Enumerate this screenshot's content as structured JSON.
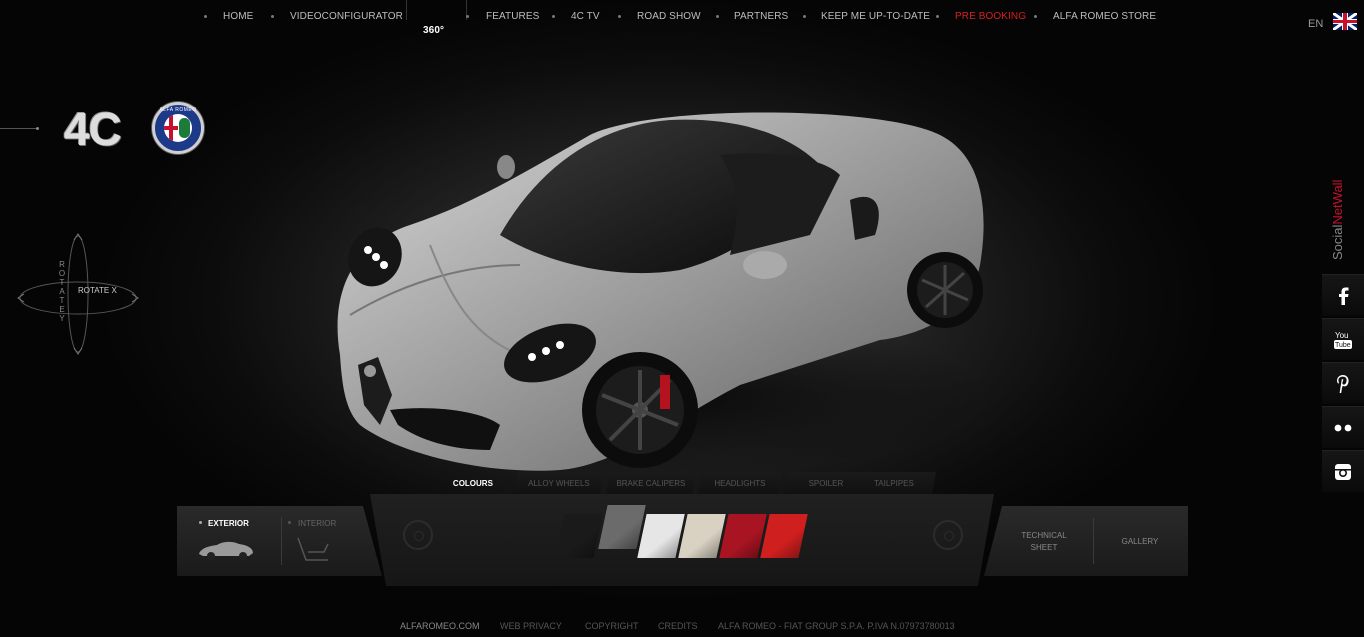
{
  "nav": {
    "items": [
      "HOME",
      "VIDEOCONFIGURATOR",
      "FEATURES",
      "4C TV",
      "ROAD SHOW",
      "PARTNERS",
      "KEEP ME UP-TO-DATE",
      "PRE BOOKING",
      "ALFA ROMEO STORE"
    ],
    "active_item": "PRE BOOKING",
    "tag": "360°"
  },
  "language": {
    "code": "EN",
    "flag": "uk-flag-icon"
  },
  "branding": {
    "model": "4C",
    "badge_text": "ALFA ROMEO",
    "badge_icon": "alfa-romeo-badge-icon"
  },
  "rotate": {
    "y_label": "ROTATE Y",
    "x_label": "ROTATE X"
  },
  "tabs": [
    "COLOURS",
    "ALLOY WHEELS",
    "BRAKE CALIPERS",
    "HEADLIGHTS",
    "SPOILER",
    "TAILPIPES"
  ],
  "active_tab": "COLOURS",
  "view_modes": {
    "exterior": "EXTERIOR",
    "interior": "INTERIOR",
    "active": "EXTERIOR"
  },
  "swatches": [
    {
      "color": "#1a1a1a",
      "name": "black"
    },
    {
      "color": "#6b6b6b",
      "name": "grey"
    },
    {
      "color": "#e6e6e6",
      "name": "white"
    },
    {
      "color": "#d9d2c3",
      "name": "pearl"
    },
    {
      "color": "#a81422",
      "name": "dark-red"
    },
    {
      "color": "#d01f1f",
      "name": "red"
    }
  ],
  "selected_swatch": "grey",
  "panel": {
    "technical": "TECHNICAL SHEET",
    "gallery": "GALLERY"
  },
  "footer": [
    "ALFAROMEO.COM",
    "WEB PRIVACY",
    "COPYRIGHT",
    "CREDITS",
    "ALFA ROMEO - FIAT GROUP S.P.A. P.IVA N.07973780013"
  ],
  "social": {
    "title_prefix": "Social",
    "title_highlight": "NetWall",
    "buttons": [
      "facebook-icon",
      "youtube-icon",
      "pinterest-icon",
      "flickr-icon",
      "instagram-icon"
    ]
  },
  "colors": {
    "accent": "#d61f1f",
    "background": "#000000",
    "nav_text": "#bdbdbd"
  }
}
